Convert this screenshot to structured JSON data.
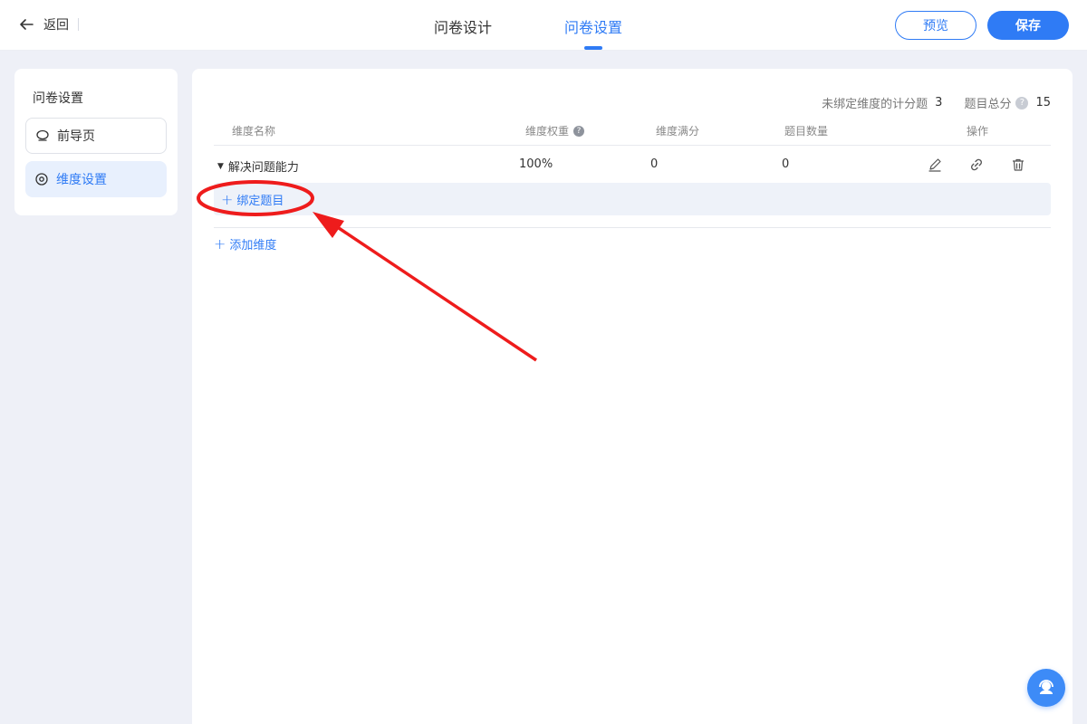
{
  "topbar": {
    "back_label": "返回",
    "tabs": [
      {
        "label": "问卷设计",
        "active": false
      },
      {
        "label": "问卷设置",
        "active": true
      }
    ],
    "preview_label": "预览",
    "save_label": "保存"
  },
  "sidebar": {
    "title": "问卷设置",
    "items": [
      {
        "label": "前导页",
        "icon": "chat-bubble-icon",
        "active": false
      },
      {
        "label": "维度设置",
        "icon": "target-icon",
        "active": true
      }
    ]
  },
  "main": {
    "summary": {
      "unbound_label": "未绑定维度的计分题",
      "unbound_count": "3",
      "total_label": "题目总分",
      "total_score": "15"
    },
    "table": {
      "headers": {
        "name": "维度名称",
        "weight": "维度权重",
        "full_score": "维度满分",
        "question_count": "题目数量",
        "actions": "操作"
      },
      "rows": [
        {
          "name": "解决问题能力",
          "weight": "100%",
          "full_score": "0",
          "question_count": "0"
        }
      ]
    },
    "bind_label": "绑定题目",
    "add_dimension_label": "添加维度"
  },
  "colors": {
    "accent": "#2f7bf5",
    "annotation_red": "#ee1c1c",
    "page_bg": "#eef0f7"
  }
}
